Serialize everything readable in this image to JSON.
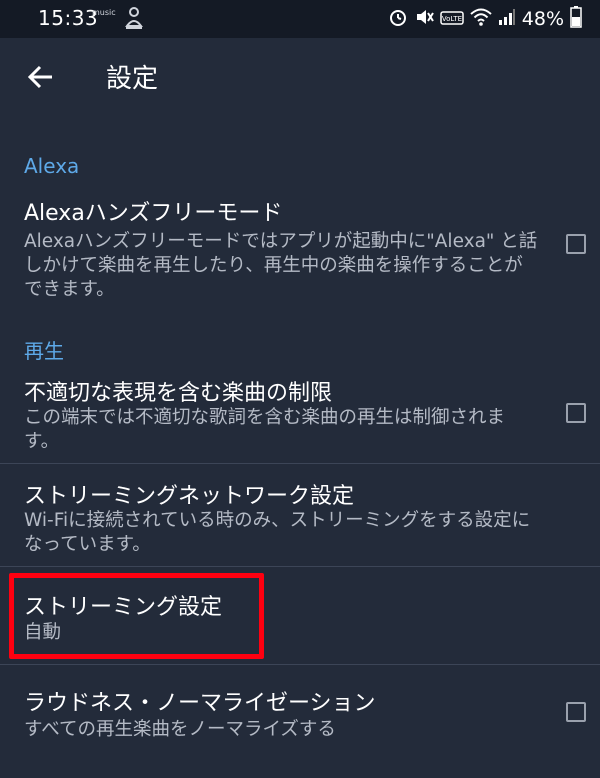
{
  "status_bar": {
    "time": "15:33",
    "music_label": "music",
    "battery": "48%",
    "icons": [
      "alarm-icon",
      "mute-icon",
      "volte-icon",
      "wifi-icon",
      "signal-icon",
      "battery-icon"
    ]
  },
  "header": {
    "title": "設定",
    "back_icon": "arrow-left-icon"
  },
  "sections": {
    "alexa": {
      "heading": "Alexa",
      "handsfree": {
        "title": "Alexaハンズフリーモード",
        "desc_lines": [
          "Alexaハンズフリーモードではアプリが起動中に\"Alexa\" と話",
          "しかけて楽曲を再生したり、再生中の楽曲を操作することが",
          "できます。"
        ],
        "checked": false
      }
    },
    "playback": {
      "heading": "再生",
      "explicit": {
        "title": "不適切な表現を含む楽曲の制限",
        "desc_lines": [
          "この端末では不適切な歌詞を含む楽曲の再生は制御されま",
          "す。"
        ],
        "checked": false
      },
      "streaming_network": {
        "title": "ストリーミングネットワーク設定",
        "desc_lines": [
          "Wi-Fiに接続されている時のみ、ストリーミングをする設定に",
          "なっています。"
        ]
      },
      "streaming": {
        "title": "ストリーミング設定",
        "value": "自動"
      },
      "loudness": {
        "title": "ラウドネス・ノーマライゼーション",
        "desc": "すべての再生楽曲をノーマライズする",
        "checked": false
      }
    }
  },
  "colors": {
    "background": "#232b3a",
    "status_bar": "#141a25",
    "accent": "#5ea9e8",
    "highlight": "#ff0010"
  }
}
